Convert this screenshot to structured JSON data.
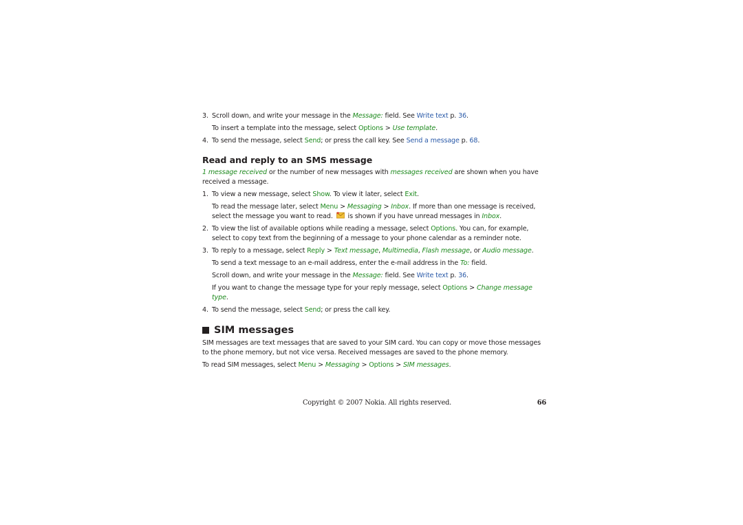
{
  "colors": {
    "text": "#231f20",
    "ui_label_green": "#1f8a1f",
    "link_blue": "#2a5aa8"
  },
  "top_list": {
    "step3": {
      "num": "3.",
      "t1": "Scroll down, and write your message in the ",
      "field": "Message:",
      "t2": " field. See ",
      "link": "Write text",
      "t3": " p. ",
      "page": "36",
      "t4": "."
    },
    "step3_sub": {
      "t1": "To insert a template into the message, select ",
      "k1": "Options",
      "sep": " > ",
      "k2": "Use template",
      "t2": "."
    },
    "step4": {
      "num": "4.",
      "t1": "To send the message, select ",
      "k1": "Send",
      "t2": "; or press the call key. See ",
      "link": "Send a message",
      "t3": " p. ",
      "page": "68",
      "t4": "."
    }
  },
  "read_reply": {
    "heading": "Read and reply to an SMS message",
    "intro": {
      "k1": "1 message received",
      "t1": " or the number of new messages with  ",
      "k2": "messages received",
      "t2": " are shown when you have received a message."
    },
    "step1": {
      "num": "1.",
      "t1": "To view a new message, select ",
      "k1": "Show",
      "t2": ". To view it later, select ",
      "k2": "Exit",
      "t3": "."
    },
    "step1_sub": {
      "t1": "To read the message later, select ",
      "k1": "Menu",
      "sep1": " > ",
      "k2": "Messaging",
      "sep2": " > ",
      "k3": "Inbox",
      "t2": ". If more than one message is received, select the message you want to read. ",
      "icon": "unread-message-envelope-icon",
      "t3": " is shown if you have unread messages in ",
      "k4": "Inbox",
      "t4": "."
    },
    "step2": {
      "num": "2.",
      "t1": "To view the list of available options while reading a message, select ",
      "k1": "Options",
      "t2": ". You can, for example, select to copy text from the beginning of a message to your phone calendar as a reminder note."
    },
    "step3": {
      "num": "3.",
      "t1": "To reply to a message, select ",
      "k1": "Reply",
      "sep": " > ",
      "k2": "Text message",
      "c1": ", ",
      "k3": "Multimedia",
      "c2": ", ",
      "k4": "Flash message",
      "c3": ", or ",
      "k5": "Audio message",
      "t2": "."
    },
    "step3_sub1": {
      "t1": "To send a text message to an e-mail address, enter the e-mail address in the ",
      "k1": "To:",
      "t2": " field."
    },
    "step3_sub2": {
      "t1": "Scroll down, and write your message in the ",
      "k1": "Message:",
      "t2": " field. See ",
      "link": "Write text",
      "t3": " p. ",
      "page": "36",
      "t4": "."
    },
    "step3_sub3": {
      "t1": "If you want to change the message type for your reply message, select ",
      "k1": "Options",
      "sep": " > ",
      "k2": "Change message type",
      "t2": "."
    },
    "step4": {
      "num": "4.",
      "t1": "To send the message, select ",
      "k1": "Send",
      "t2": "; or press the call key."
    }
  },
  "sim_messages": {
    "heading": "SIM messages",
    "para1": "SIM messages are text messages that are saved to your SIM card. You can copy or move those messages to the phone memory, but not vice versa. Received messages are saved to the phone memory.",
    "para2": {
      "t1": "To read SIM messages, select ",
      "k1": "Menu",
      "sep1": " > ",
      "k2": "Messaging",
      "sep2": " > ",
      "k3": "Options",
      "sep3": " > ",
      "k4": "SIM messages",
      "t2": "."
    }
  },
  "footer": {
    "copyright": "Copyright © 2007 Nokia. All rights reserved.",
    "page_number": "66"
  }
}
